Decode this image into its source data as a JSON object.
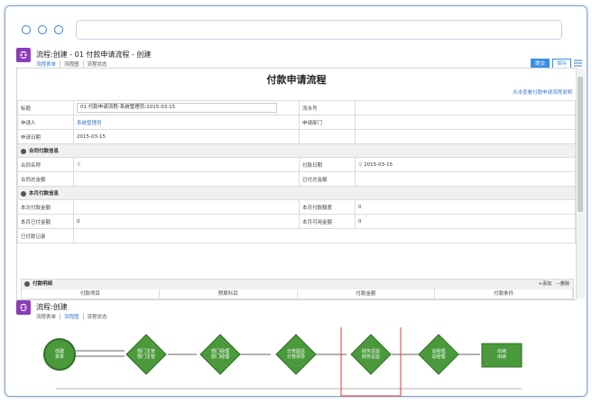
{
  "titlebar": {
    "tab_count": 3
  },
  "section1": {
    "title": "流程:创建 - 01 付款申请流程 - 创建",
    "tabs": [
      "流程表单",
      "流程图",
      "流程状态"
    ],
    "submit_label": "提交",
    "save_label": "保存"
  },
  "form": {
    "title": "付款申请流程",
    "explain_link": "点击查看付款申请流程说明",
    "rows": {
      "subject_label": "标题",
      "subject_value": "01 付款申请流程-系统管理员-2015-03-15",
      "serial_label": "流水号",
      "applicant_label": "申请人",
      "applicant_value": "系统管理员",
      "dept_label": "申请部门",
      "date_label": "申请日期",
      "date_value": "2015-03-15"
    },
    "contract_group": "合同付款信息",
    "contract_name_label": "合同名称",
    "pay_date_label": "付款日期",
    "pay_date_value": "2015-03-15",
    "contract_total_label": "合同总金额",
    "paid_total_label": "已付总金额",
    "month_group": "本月付款信息",
    "this_amount_label": "本次付款金额",
    "month_quota_label": "本月付款额度",
    "month_quota_value": "0",
    "month_paid_label": "本月已付金额",
    "month_paid_value": "0",
    "month_avail_label": "本月可用金额",
    "month_avail_value": "0",
    "records_label": "已付款记录",
    "detail": {
      "title": "付款明细",
      "add_label": "添加",
      "delete_label": "删除",
      "columns": [
        "付款项目",
        "预算科目",
        "付款金额",
        "付款条件"
      ]
    }
  },
  "section2": {
    "title": "流程:创建",
    "tabs": [
      "流程表单",
      "流程图",
      "流程状态"
    ]
  },
  "flow": {
    "start": [
      "创建",
      "单单"
    ],
    "nodes": [
      [
        "部门主管",
        "部门主管"
      ],
      [
        "部门经理",
        "部门经理"
      ],
      [
        "分管副总",
        "分管领导"
      ],
      [
        "财务总监",
        "财务总监"
      ],
      [
        "总经理",
        "总经理"
      ]
    ],
    "end": [
      "出纳",
      "出纳"
    ]
  },
  "colors": {
    "accent": "#3a8ee6",
    "node": "#4a9a3c",
    "highlight": "#e03a3a",
    "logo": "#8a3db6"
  }
}
